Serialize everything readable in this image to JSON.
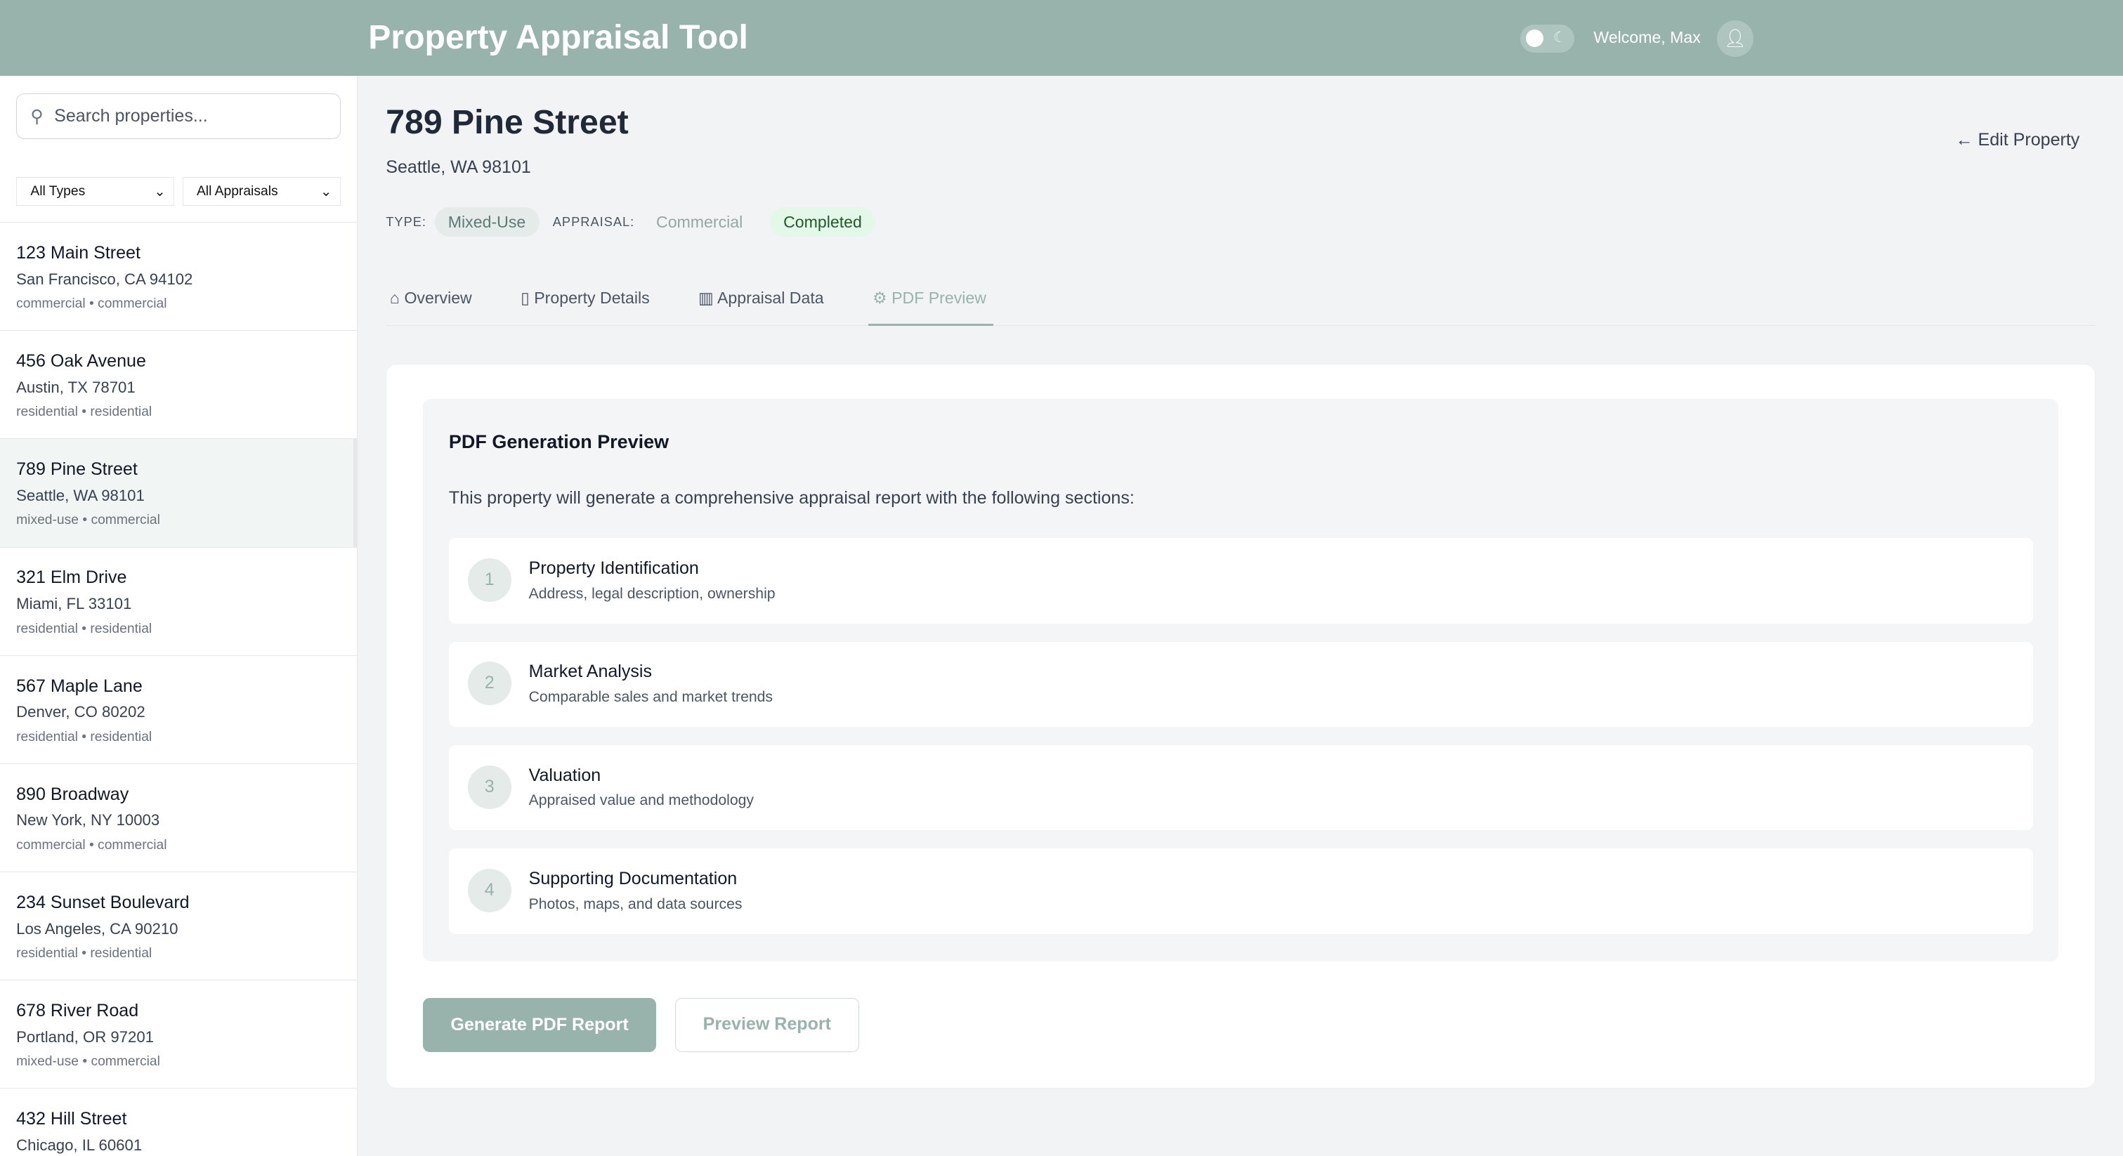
{
  "header": {
    "title": "Property Appraisal Tool",
    "welcome": "Welcome, Max"
  },
  "sidebar": {
    "search_placeholder": "Search properties...",
    "filter_type": "All Types",
    "filter_appraisal": "All Appraisals",
    "items": [
      {
        "name": "123 Main Street",
        "address": "San Francisco, CA 94102",
        "tags": "commercial • commercial"
      },
      {
        "name": "456 Oak Avenue",
        "address": "Austin, TX 78701",
        "tags": "residential • residential"
      },
      {
        "name": "789 Pine Street",
        "address": "Seattle, WA 98101",
        "tags": "mixed-use • commercial"
      },
      {
        "name": "321 Elm Drive",
        "address": "Miami, FL 33101",
        "tags": "residential • residential"
      },
      {
        "name": "567 Maple Lane",
        "address": "Denver, CO 80202",
        "tags": "residential • residential"
      },
      {
        "name": "890 Broadway",
        "address": "New York, NY 10003",
        "tags": "commercial • commercial"
      },
      {
        "name": "234 Sunset Boulevard",
        "address": "Los Angeles, CA 90210",
        "tags": "residential • residential"
      },
      {
        "name": "678 River Road",
        "address": "Portland, OR 97201",
        "tags": "mixed-use • commercial"
      },
      {
        "name": "432 Hill Street",
        "address": "Chicago, IL 60601",
        "tags": ""
      }
    ]
  },
  "property": {
    "title": "789 Pine Street",
    "address": "Seattle, WA 98101",
    "edit_label": "Edit Property",
    "type_label": "TYPE:",
    "type": "Mixed-Use",
    "appraisal_label": "APPRAISAL:",
    "appraisal": "Commercial",
    "status": "Completed"
  },
  "tabs": [
    "Overview",
    "Property Details",
    "Appraisal Data",
    "PDF Preview"
  ],
  "pdf": {
    "heading": "PDF Generation Preview",
    "intro": "This property will generate a comprehensive appraisal report with the following sections:",
    "sections": [
      {
        "num": "1",
        "title": "Property Identification",
        "desc": "Address, legal description, ownership"
      },
      {
        "num": "2",
        "title": "Market Analysis",
        "desc": "Comparable sales and market trends"
      },
      {
        "num": "3",
        "title": "Valuation",
        "desc": "Appraised value and methodology"
      },
      {
        "num": "4",
        "title": "Supporting Documentation",
        "desc": "Photos, maps, and data sources"
      }
    ],
    "generate_label": "Generate PDF Report",
    "preview_label": "Preview Report"
  },
  "colors": {
    "accent": "#97b3ab",
    "status_bg": "#e3f8e8",
    "status_text": "#1f5a2a"
  }
}
